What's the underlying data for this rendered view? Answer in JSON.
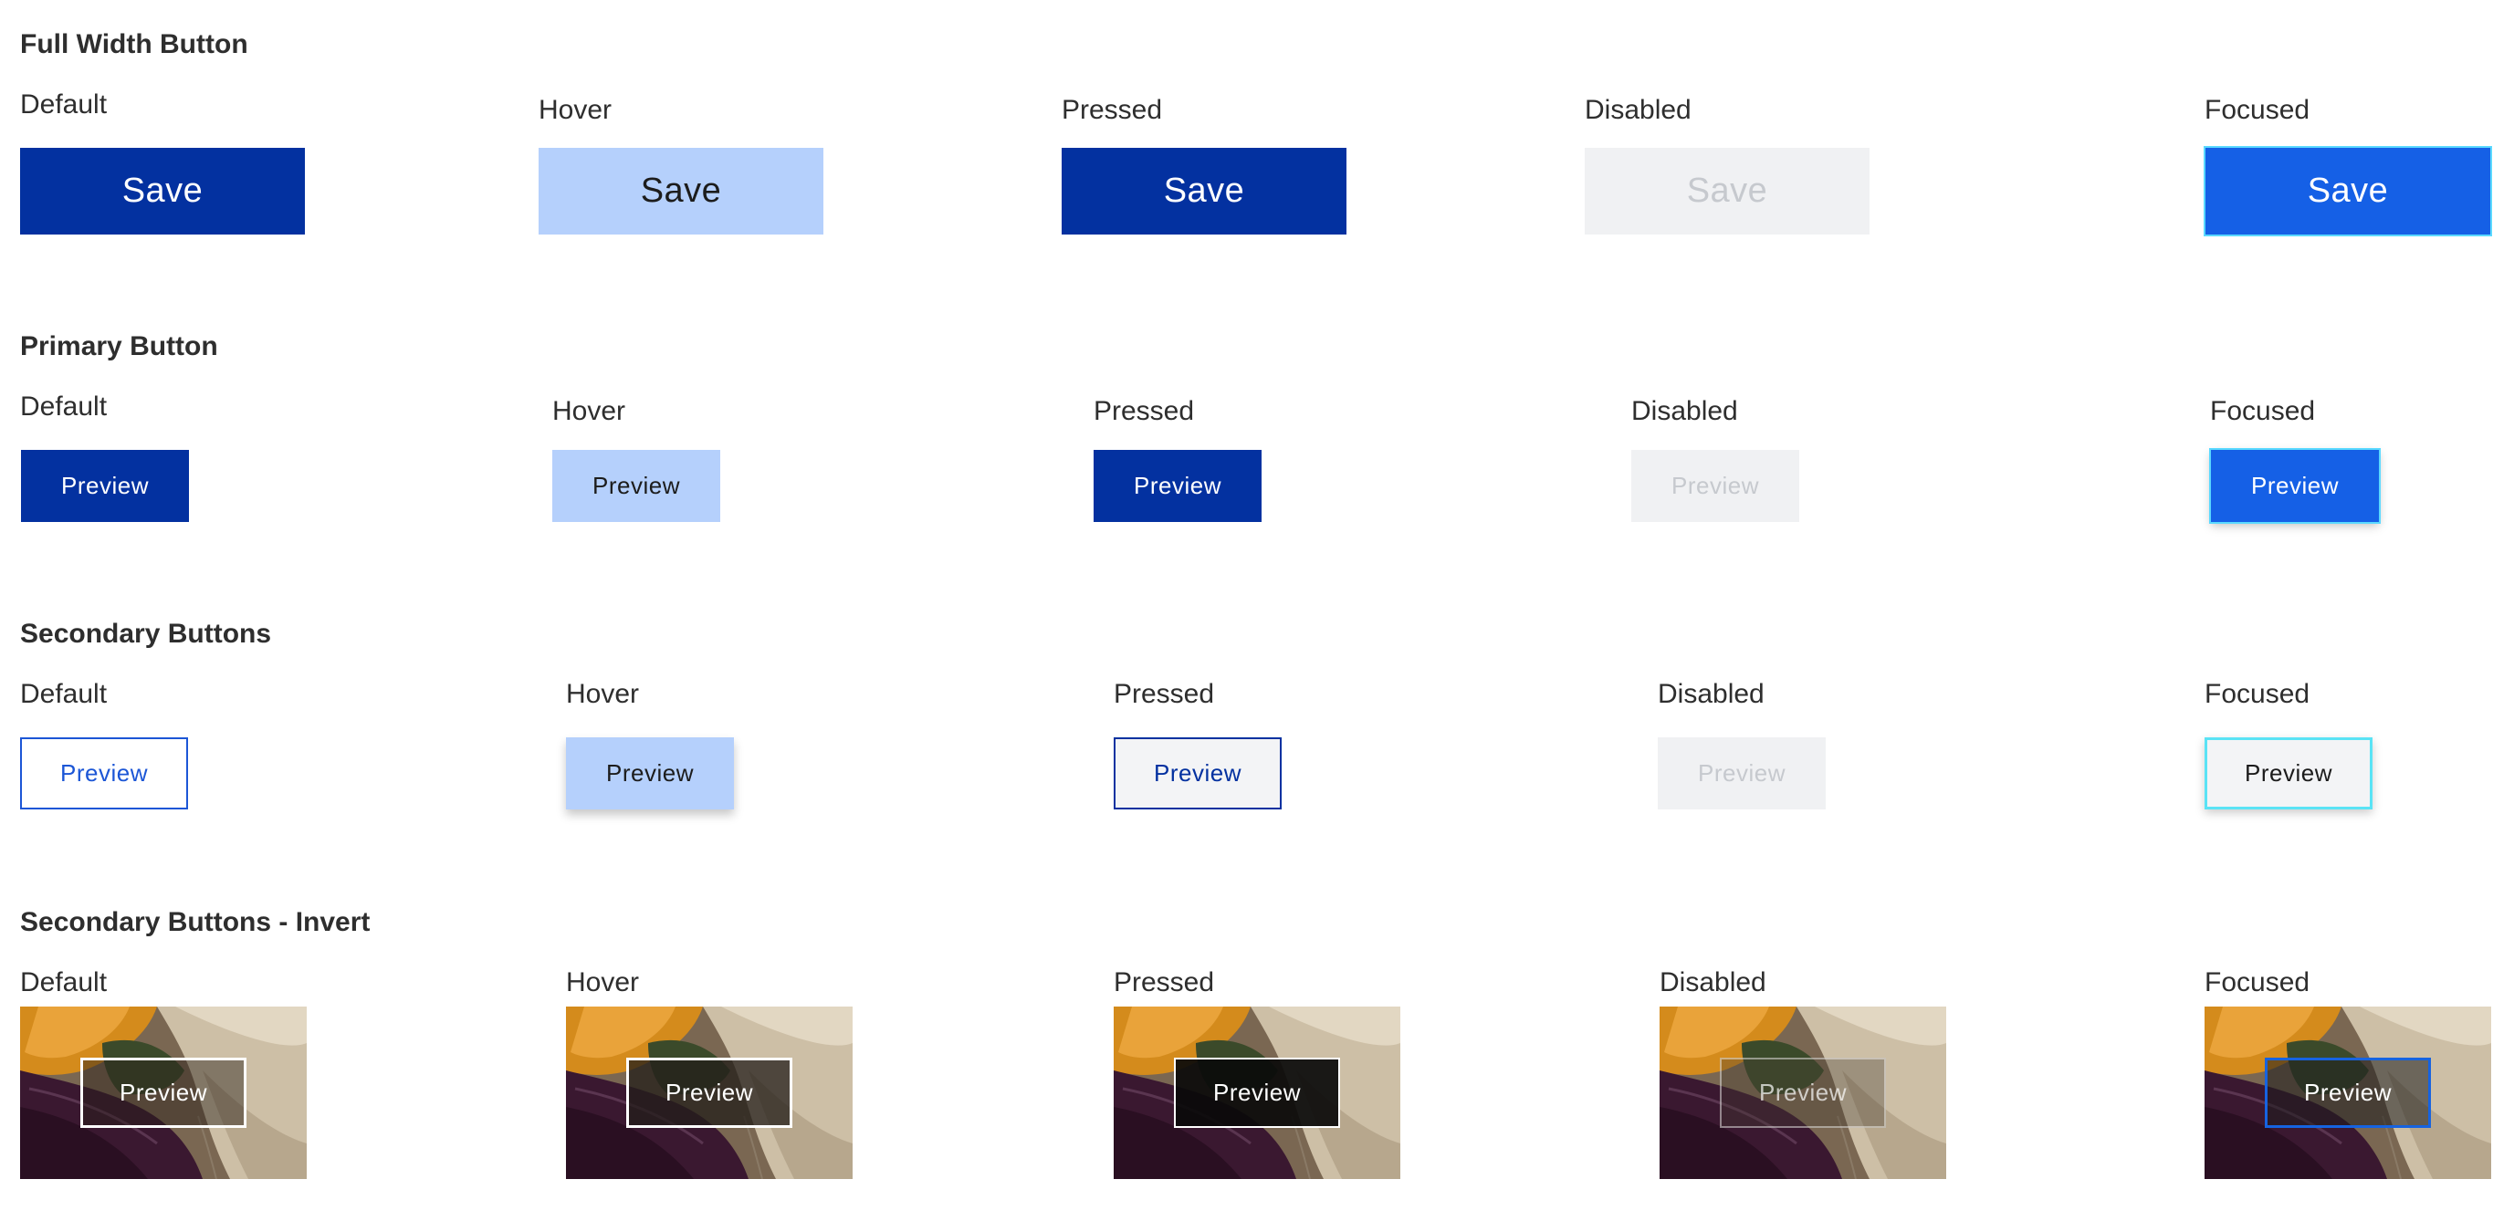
{
  "states": {
    "default": "Default",
    "hover": "Hover",
    "pressed": "Pressed",
    "disabled": "Disabled",
    "focused": "Focused"
  },
  "sections": {
    "full_width": {
      "title": "Full Width Button",
      "button_label": "Save"
    },
    "primary": {
      "title": "Primary Button",
      "button_label": "Preview"
    },
    "secondary": {
      "title": "Secondary Buttons",
      "button_label": "Preview"
    },
    "secondary_invert": {
      "title": "Secondary Buttons - Invert",
      "button_label": "Preview"
    }
  },
  "colors": {
    "primary_default": "#0331a0",
    "hover": "#b5d0fc",
    "disabled_bg": "#f0f1f3",
    "focused": "#1560e6",
    "focus_ring": "#5ad9ff",
    "secondary_outline": "#1c56d6"
  }
}
